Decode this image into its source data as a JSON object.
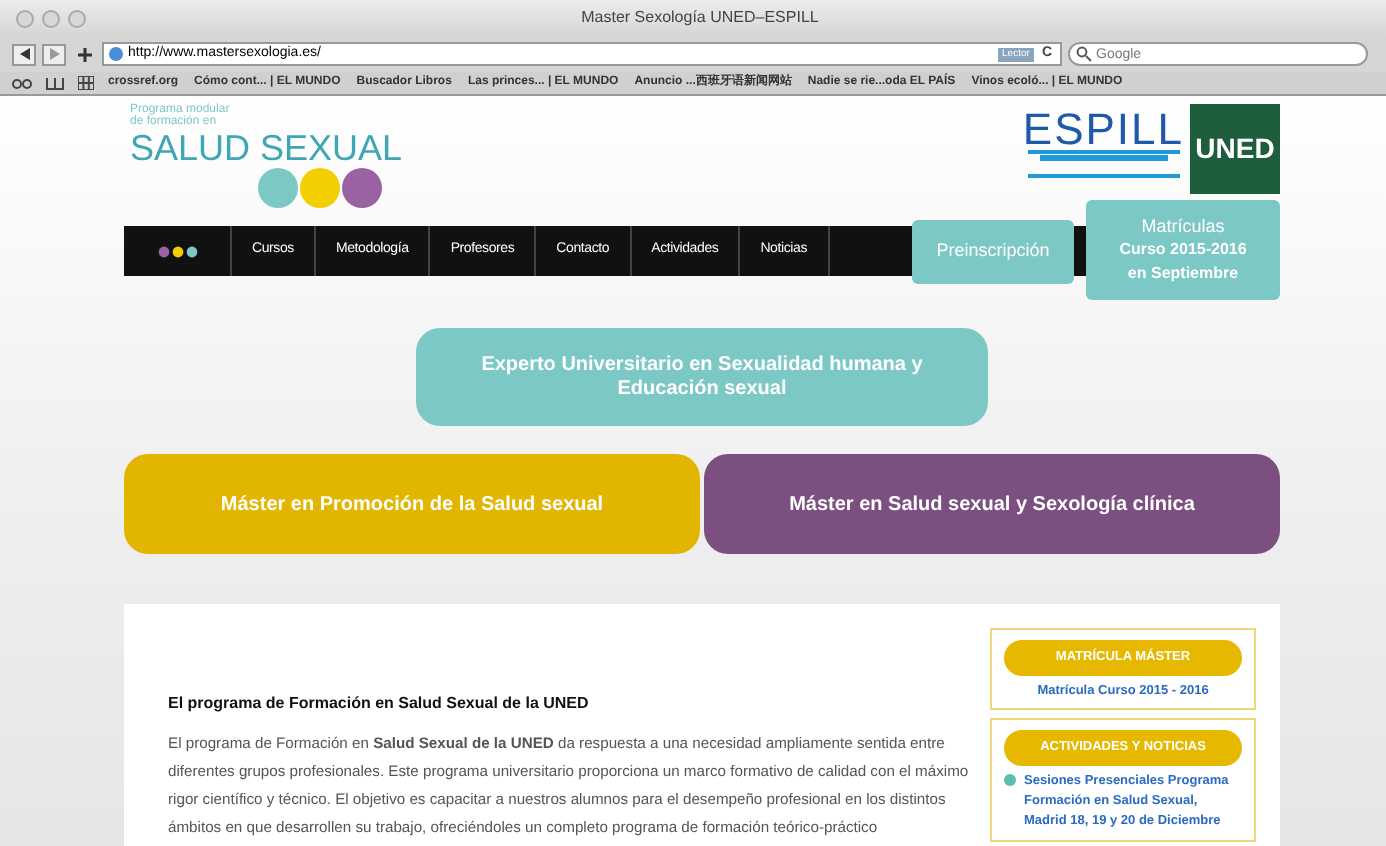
{
  "window": {
    "title": "Master Sexología UNED–ESPILL"
  },
  "toolbar": {
    "url": "http://www.mastersexologia.es/",
    "reader_button": "Lector",
    "reload": "C",
    "search": {
      "placeholder": "Google"
    }
  },
  "bookmarks": [
    "crossref.org",
    "Cómo cont... | EL MUNDO",
    "Buscador Libros",
    "Las princes... | EL MUNDO",
    "Anuncio ...西班牙语新闻网站",
    "Nadie se rie...oda EL PAÍS",
    "Vinos ecoló... | EL MUNDO"
  ],
  "logo": {
    "subtitle_1": "Programa modular",
    "subtitle_2": "de formación en",
    "title": "SALUD SEXUAL"
  },
  "partner_logos": {
    "espill": "ESPILL",
    "uned": "UNED"
  },
  "nav": [
    {
      "kind": "dots"
    },
    {
      "kind": "link",
      "label": "Cursos"
    },
    {
      "kind": "link",
      "label": "Metodología"
    },
    {
      "kind": "link",
      "label": "Profesores"
    },
    {
      "kind": "link",
      "label": "Contacto"
    },
    {
      "kind": "link",
      "label": "Actividades"
    },
    {
      "kind": "link",
      "label": "Noticias"
    }
  ],
  "preinscripcion": "Preinscripción",
  "matriculas": {
    "title": "Matrículas",
    "line_1": "Curso 2015-2016",
    "line_2": "en Septiembre"
  },
  "courses": [
    {
      "label": "Experto Universitario en Sexualidad humana y Educación sexual",
      "color": "#7cc8c5"
    },
    {
      "label": "Máster en Promoción de la Salud sexual",
      "color": "#e2b500"
    },
    {
      "label": "Máster en Salud sexual y Sexología clínica",
      "color": "#7b4f80"
    }
  ],
  "article": {
    "heading": "El programa de Formación en Salud Sexual de la UNED",
    "body": "El programa de Formación en **Salud Sexual de la UNED** da respuesta a una necesidad ampliamente sentida entre diferentes grupos profesionales. Este programa universitario proporciona un marco formativo de calidad con el máximo rigor científico y técnico. El objetivo es capacitar a nuestros alumnos para el desempeño profesional en los distintos ámbitos en que desarrollen su trabajo, ofreciéndoles un completo programa de formación teórico-práctico"
  },
  "sidebar": [
    {
      "title": "MATRÍCULA MÁSTER",
      "links": [
        "Matrícula Curso 2015 - 2016"
      ]
    },
    {
      "title": "ACTIVIDADES Y NOTICIAS",
      "links": [
        "Sesiones Presenciales Programa Formación en Salud Sexual, Madrid 18, 19 y 20 de Diciembre"
      ]
    }
  ]
}
